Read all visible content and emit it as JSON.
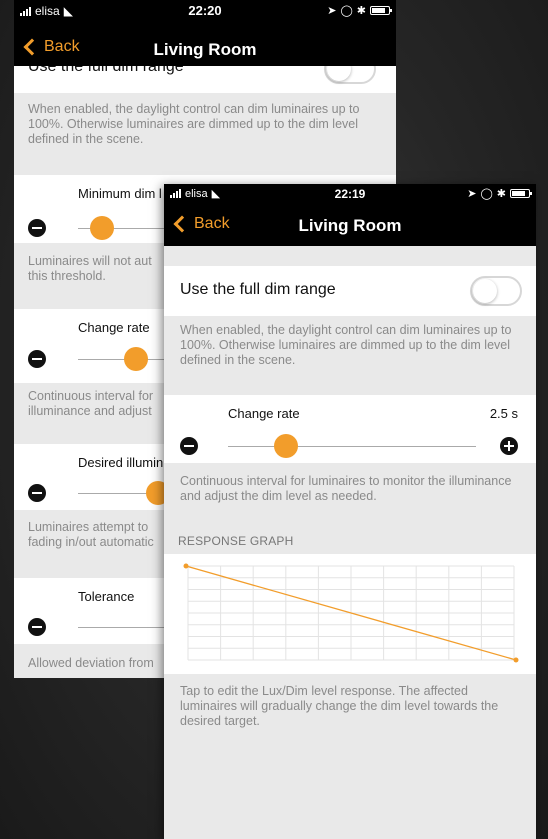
{
  "colors": {
    "accent": "#f29d2b",
    "background": "#e9e9e9",
    "bar": "#000000"
  },
  "back_screen": {
    "status": {
      "carrier": "elisa",
      "time": "22:20"
    },
    "nav": {
      "back_label": "Back",
      "title": "Living Room"
    },
    "full_dim": {
      "label": "Use the full dim range",
      "enabled": false,
      "description": "When enabled, the daylight control can dim luminaires up to 100%. Otherwise luminaires are dimmed up to the dim level defined in the scene."
    },
    "minimum_dim": {
      "label": "Minimum dim l",
      "level": 0.13,
      "description_1": "Luminaires will not aut",
      "description_2": "this threshold."
    },
    "change_rate": {
      "label": "Change rate",
      "level": 0.4,
      "description_1": "Continuous interval for",
      "description_2": "illuminance and adjust"
    },
    "desired_illum": {
      "label": "Desired illumin",
      "level": 0.7,
      "description_1": "Luminaires attempt to",
      "description_2": "fading in/out automatic"
    },
    "tolerance": {
      "label": "Tolerance",
      "description": "Allowed deviation from"
    }
  },
  "front_screen": {
    "status": {
      "carrier": "elisa",
      "time": "22:19"
    },
    "nav": {
      "back_label": "Back",
      "title": "Living Room"
    },
    "full_dim": {
      "label": "Use the full dim range",
      "enabled": false,
      "description": "When enabled, the daylight control can dim luminaires up to 100%. Otherwise luminaires are dimmed up to the dim level defined in the scene."
    },
    "change_rate": {
      "label": "Change rate",
      "value": "2.5 s",
      "level": 0.2,
      "description": "Continuous interval for luminaires to monitor the illuminance and adjust the dim level as needed."
    },
    "response_graph": {
      "header": "RESPONSE GRAPH",
      "start_level": 1.0,
      "end_level": 0.0,
      "description": "Tap to edit the Lux/Dim level response. The affected luminaires will gradually change the dim level towards the desired target."
    }
  }
}
